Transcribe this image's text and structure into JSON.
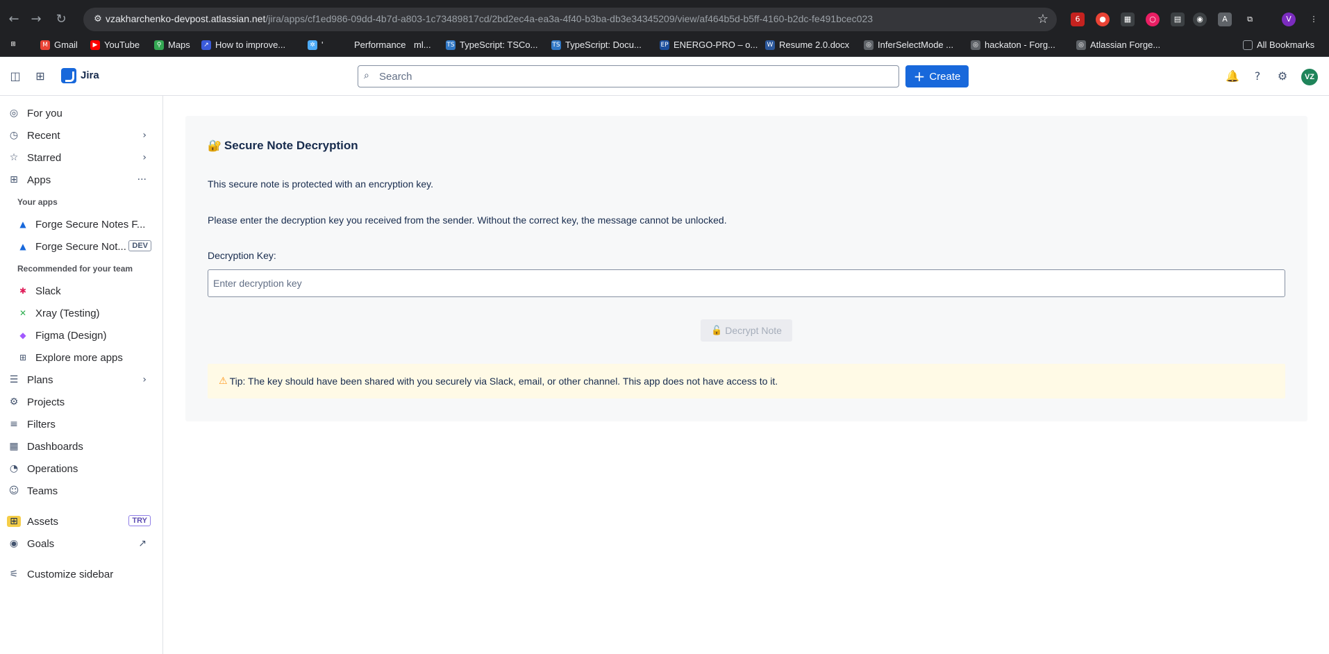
{
  "browser": {
    "url_host": "vzakharchenko-devpost.atlassian.net",
    "url_path": "/jira/apps/cf1ed986-09dd-4b7d-a803-1c73489817cd/2bd2ec4a-ea3a-4f40-b3ba-db3e34345209/view/af464b5d-b5ff-4160-b2dc-fe491bcec023",
    "ext_badge": "6",
    "profile_initial": "V",
    "bookmarks": [
      {
        "label": "Gmail",
        "color": "#ea4335",
        "glyph": "M"
      },
      {
        "label": "YouTube",
        "color": "#ff0000",
        "glyph": "▶"
      },
      {
        "label": "Maps",
        "color": "#34a853",
        "glyph": "⚲"
      },
      {
        "label": "How to improve...",
        "color": "#3b5bdb",
        "glyph": "↗"
      },
      {
        "label": "'",
        "color": "#4dabf7",
        "glyph": "✲"
      },
      {
        "label": "Performance",
        "color": "#202124",
        "glyph": ""
      },
      {
        "label": "ml...",
        "color": "#202124",
        "glyph": ""
      },
      {
        "label": "TypeScript: TSCo...",
        "color": "#3178c6",
        "glyph": "TS"
      },
      {
        "label": "TypeScript: Docu...",
        "color": "#3178c6",
        "glyph": "TS"
      },
      {
        "label": "ENERGO-PRO – o...",
        "color": "#1c4e9c",
        "glyph": "EP"
      },
      {
        "label": "Resume 2.0.docx",
        "color": "#2b579a",
        "glyph": "W"
      },
      {
        "label": "InferSelectMode ...",
        "color": "#5f6368",
        "glyph": "◎"
      },
      {
        "label": "hackaton - Forg...",
        "color": "#5f6368",
        "glyph": "◎"
      },
      {
        "label": "Atlassian Forge...",
        "color": "#5f6368",
        "glyph": "◎"
      }
    ],
    "all_bookmarks": "All Bookmarks"
  },
  "topnav": {
    "product": "Jira",
    "search_placeholder": "Search",
    "create_label": "Create",
    "avatar_initials": "VZ"
  },
  "sidebar": {
    "items_top": [
      {
        "label": "For you",
        "icon": "user-circle-icon",
        "glyph": "◎"
      },
      {
        "label": "Recent",
        "icon": "clock-icon",
        "glyph": "◷"
      },
      {
        "label": "Starred",
        "icon": "star-icon",
        "glyph": "☆"
      },
      {
        "label": "Apps",
        "icon": "apps-icon",
        "glyph": "⊞"
      }
    ],
    "your_apps_label": "Your apps",
    "your_apps": [
      {
        "label": "Forge Secure Notes F...",
        "tag": ""
      },
      {
        "label": "Forge Secure Not...",
        "tag": "DEV"
      }
    ],
    "recommended_label": "Recommended for your team",
    "recommended": [
      {
        "label": "Slack",
        "color": "#e01e5a",
        "glyph": "✱"
      },
      {
        "label": "Xray (Testing)",
        "color": "#2eae4f",
        "glyph": "✕"
      },
      {
        "label": "Figma (Design)",
        "color": "#a259ff",
        "glyph": "◆"
      },
      {
        "label": "Explore more apps",
        "color": "#44546f",
        "glyph": "⊞"
      }
    ],
    "items_bottom": [
      {
        "label": "Plans",
        "glyph": "☰"
      },
      {
        "label": "Projects",
        "glyph": "⚙"
      },
      {
        "label": "Filters",
        "glyph": "≡"
      },
      {
        "label": "Dashboards",
        "glyph": "▦"
      },
      {
        "label": "Operations",
        "glyph": "◔"
      },
      {
        "label": "Teams",
        "glyph": "☺"
      }
    ],
    "assets": {
      "label": "Assets",
      "tag": "TRY"
    },
    "goals": {
      "label": "Goals"
    },
    "customize": {
      "label": "Customize sidebar"
    }
  },
  "main": {
    "title": "Secure Note Decryption",
    "intro": "This secure note is protected with an encryption key.",
    "instructions": "Please enter the decryption key you received from the sender. Without the correct key, the message cannot be unlocked.",
    "key_label": "Decryption Key:",
    "key_placeholder": "Enter decryption key",
    "decrypt_label": "Decrypt Note",
    "tip": "Tip: The key should have been shared with you securely via Slack, email, or other channel. This app does not have access to it."
  }
}
